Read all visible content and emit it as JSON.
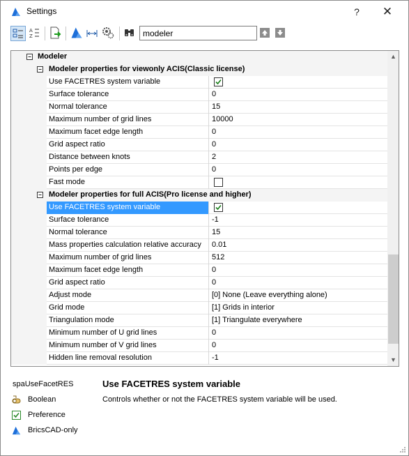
{
  "window": {
    "title": "Settings",
    "help_glyph": "?",
    "close_glyph": "✕"
  },
  "toolbar": {
    "search_value": "modeler",
    "buttons": [
      "categorized-view-icon",
      "alphabetical-view-icon",
      "export-icon",
      "bricscad-filter-icon",
      "dimension-icon",
      "settings-gear-icon",
      "binoculars-icon",
      "arrow-up-icon",
      "arrow-down-icon"
    ]
  },
  "grid": {
    "root": {
      "label": "Modeler",
      "expander": "−"
    },
    "sections": [
      {
        "label": "Modeler properties for viewonly ACIS(Classic license)",
        "expander": "−",
        "rows": [
          {
            "name": "Use FACETRES system variable",
            "value": "",
            "checkbox": true,
            "checked": true
          },
          {
            "name": "Surface tolerance",
            "value": "0"
          },
          {
            "name": "Normal tolerance",
            "value": "15"
          },
          {
            "name": "Maximum number of grid lines",
            "value": "10000"
          },
          {
            "name": "Maximum facet edge length",
            "value": "0"
          },
          {
            "name": "Grid aspect ratio",
            "value": "0"
          },
          {
            "name": "Distance between knots",
            "value": "2"
          },
          {
            "name": "Points per edge",
            "value": "0"
          },
          {
            "name": "Fast mode",
            "value": "",
            "checkbox": true,
            "checked": false
          }
        ]
      },
      {
        "label": "Modeler properties for full ACIS(Pro license and higher)",
        "expander": "−",
        "rows": [
          {
            "name": "Use FACETRES system variable",
            "value": "",
            "checkbox": true,
            "checked": true,
            "selected": true
          },
          {
            "name": "Surface tolerance",
            "value": "-1"
          },
          {
            "name": "Normal tolerance",
            "value": "15"
          },
          {
            "name": "Mass properties calculation relative accuracy",
            "value": "0.01"
          },
          {
            "name": "Maximum number of grid lines",
            "value": "512"
          },
          {
            "name": "Maximum facet edge length",
            "value": "0"
          },
          {
            "name": "Grid aspect ratio",
            "value": "0"
          },
          {
            "name": "Adjust mode",
            "value": "[0] None (Leave everything alone)"
          },
          {
            "name": "Grid mode",
            "value": "[1] Grids in interior"
          },
          {
            "name": "Triangulation mode",
            "value": "[1] Triangulate everywhere"
          },
          {
            "name": "Minimum number of U grid lines",
            "value": "0"
          },
          {
            "name": "Minimum number of V grid lines",
            "value": "0"
          },
          {
            "name": "Hidden line removal resolution",
            "value": "-1"
          }
        ]
      }
    ],
    "scroll_up_glyph": "▲",
    "scroll_down_glyph": "▼"
  },
  "description": {
    "variable_name": "spaUseFacetRES",
    "title": "Use FACETRES system variable",
    "text": "Controls whether or not the FACETRES system variable will be used.",
    "type_label": "Boolean",
    "storage_label": "Preference",
    "scope_label": "BricsCAD-only"
  },
  "colors": {
    "selection": "#3399ff",
    "brand_blue": "#1e6fd9",
    "checkmark": "#1a7f1a"
  }
}
